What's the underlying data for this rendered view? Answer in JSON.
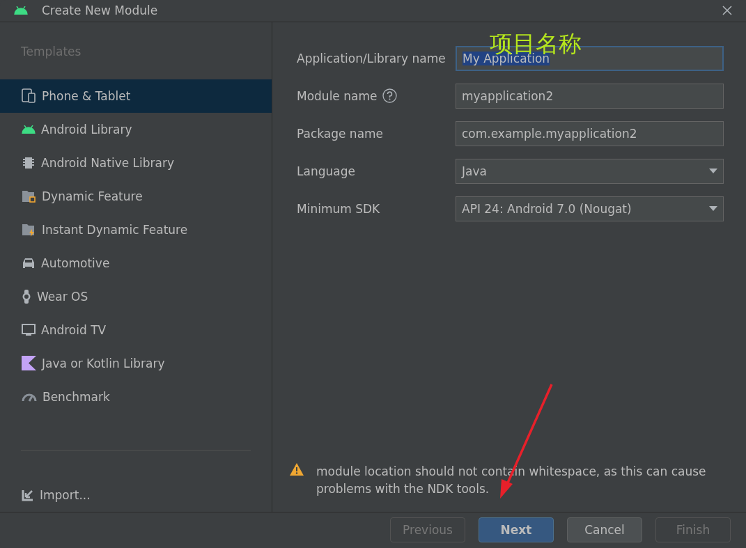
{
  "window": {
    "title": "Create New Module"
  },
  "sidebar": {
    "heading": "Templates",
    "items": [
      {
        "label": "Phone & Tablet",
        "selected": true
      },
      {
        "label": "Android Library",
        "selected": false
      },
      {
        "label": "Android Native Library",
        "selected": false
      },
      {
        "label": "Dynamic Feature",
        "selected": false
      },
      {
        "label": "Instant Dynamic Feature",
        "selected": false
      },
      {
        "label": "Automotive",
        "selected": false
      },
      {
        "label": "Wear OS",
        "selected": false
      },
      {
        "label": "Android TV",
        "selected": false
      },
      {
        "label": "Java or Kotlin Library",
        "selected": false
      },
      {
        "label": "Benchmark",
        "selected": false
      }
    ],
    "import": "Import..."
  },
  "form": {
    "fields": [
      {
        "kind": "text",
        "label": "Application/Library name",
        "value": "My Application",
        "focused": true,
        "help": false
      },
      {
        "kind": "text",
        "label": "Module name",
        "value": "myapplication2",
        "focused": false,
        "help": true
      },
      {
        "kind": "text",
        "label": "Package name",
        "value": "com.example.myapplication2",
        "focused": false,
        "help": false
      },
      {
        "kind": "dropdown",
        "label": "Language",
        "value": "Java",
        "focused": false,
        "help": false
      },
      {
        "kind": "dropdown",
        "label": "Minimum SDK",
        "value": "API 24: Android 7.0 (Nougat)",
        "focused": false,
        "help": false
      }
    ],
    "warning": "module location should not contain whitespace, as this can cause problems with the NDK tools."
  },
  "annotation": {
    "text": "项目名称"
  },
  "buttons": [
    {
      "label": "Previous",
      "disabled": true,
      "default": false
    },
    {
      "label": "Next",
      "disabled": false,
      "default": true
    },
    {
      "label": "Cancel",
      "disabled": false,
      "default": false
    },
    {
      "label": "Finish",
      "disabled": true,
      "default": false
    }
  ]
}
